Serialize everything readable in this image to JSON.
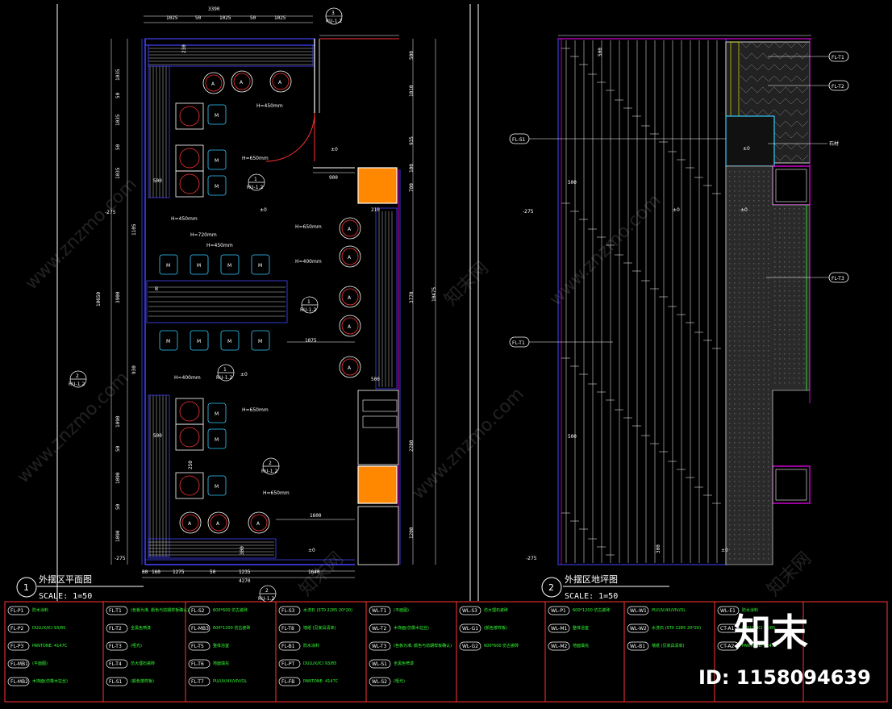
{
  "plan1": {
    "title": "外摆区平面图",
    "scale": "SCALE:  1=50",
    "number": "1",
    "top_dims": [
      "1025",
      "50",
      "1025",
      "50",
      "1025"
    ],
    "top_total": "3390",
    "bottom_dims": [
      "60",
      "160",
      "1275",
      "50",
      "1235",
      "1640"
    ],
    "bottom_total": "4270",
    "left_dims": [
      "1035",
      "50",
      "1035",
      "50",
      "1035",
      "1105",
      "3900",
      "930",
      "1090",
      "50",
      "1090",
      "50",
      "1090"
    ],
    "left_total": "10650",
    "right_dims": [
      "500",
      "1010",
      "935",
      "100",
      "700",
      "3770",
      "2280",
      "1200"
    ],
    "right_total": "10475",
    "height_notes": [
      "H=450mm",
      "H=650mm",
      "H=450mm",
      "H=720mm",
      "H=450mm",
      "H=650mm",
      "H=400mm",
      "H=400mm",
      "H=650mm",
      "H=650mm"
    ],
    "inner_dims": [
      "900",
      "210",
      "1075",
      "500",
      "500",
      "1600",
      "300",
      "230",
      "500",
      "500",
      "250"
    ],
    "levels": [
      "±0",
      "±0",
      "±0",
      "-275",
      "-275",
      "±0"
    ],
    "seat_a": "A",
    "seat_m": "M",
    "bench_b": "B",
    "callouts": [
      {
        "n": "3",
        "ref": "RU-1.2"
      },
      {
        "n": "1",
        "ref": "RU-1.2"
      },
      {
        "n": "1",
        "ref": "RU-1.2"
      },
      {
        "n": "2",
        "ref": "RU-1.2"
      },
      {
        "n": "1",
        "ref": "RU-1.2"
      },
      {
        "n": "2",
        "ref": "RU-1.2"
      },
      {
        "n": "2",
        "ref": "RU-1.2"
      }
    ]
  },
  "plan2": {
    "title": "外摆区地坪图",
    "scale": "SCALE:  1=50",
    "number": "2",
    "tags": [
      "FL-T1",
      "FL-T2",
      "FL-S1",
      "FL-T3",
      "FL-T1"
    ],
    "dims": [
      "500",
      "500",
      "500",
      "300"
    ],
    "levels": [
      "-275",
      "±0",
      "±0",
      "±0",
      "-275",
      "±0"
    ],
    "note": "石材"
  },
  "legend": {
    "codes": [
      "FL-P1",
      "FL-P2",
      "FL-P3",
      "FL-MB1",
      "FL-MB2",
      "FL-T1",
      "FL-T2",
      "FL-T3",
      "FL-T4",
      "FL-S1",
      "FL-S2",
      "FL-MB3",
      "FL-T5",
      "FL-T6",
      "FL-T7",
      "FL-S3",
      "FL-T8",
      "FL-B1",
      "FL-PT",
      "FL-FB",
      "WL-T1",
      "WL-T2",
      "WL-T3",
      "WL-S1",
      "WL-S2",
      "WL-S3",
      "WL-G1",
      "WL-G2",
      "WL-P1",
      "WL-M1",
      "WL-M2",
      "WL-W1",
      "WL-W2",
      "WL-B1",
      "WL-E1",
      "CT-A1",
      "CT-A2"
    ],
    "notes": [
      "防水涂料",
      "DULUX/ICI 93/85",
      "PANTONE: 4147C",
      "(平面图)",
      "木饰面(仿橡木拉丝)",
      "(色板为准, 颜色与前期样板确认)",
      "全黑色喷漆",
      "(哑光)",
      "仿大理石瓷砖",
      "(颜色按样板)",
      "600*600 仿古瓷砖",
      "600*1200 仿古瓷砖",
      "整体浴室",
      "地面填充",
      "PU/UV/4X/VIV/OL",
      "水洗石 (ST0 2285 20*20)",
      "墙纸 (见家具清单)"
    ]
  },
  "watermark": {
    "site": "www.znzmo.com",
    "brand": "知末网",
    "logo": "知末",
    "id_label": "ID: 1158094639"
  }
}
